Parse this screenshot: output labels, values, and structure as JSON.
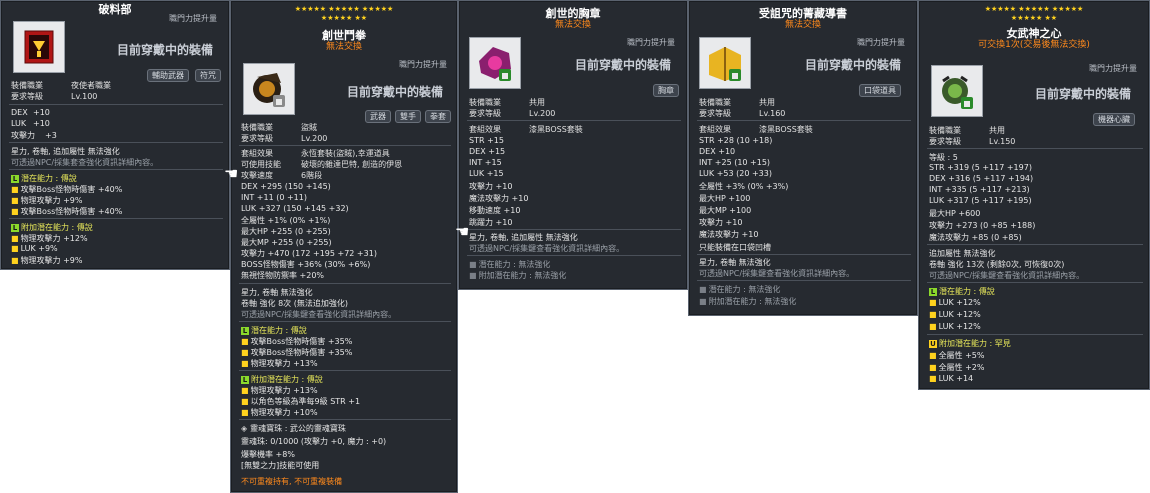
{
  "p1": {
    "title": "破料部",
    "role_power": "職門力提升量",
    "wearing": "目前穿戴中的裝備",
    "job_label": "裝備職業",
    "job_value": "夜使者職業",
    "level_label": "要求等級",
    "level_value": "Lv.100",
    "tags": [
      "輔助武器",
      "符咒"
    ],
    "stats": [
      {
        "k": "DEX",
        "v": "+10"
      },
      {
        "k": "LUK",
        "v": "+10"
      },
      {
        "k": "攻擊力",
        "v": "+3"
      }
    ],
    "info1": "星力, 卷軸, 追加屬性 無法強化",
    "info2": "可透過NPC/採集套查強化資訊詳細內容。",
    "potential_label": "潛在能力 : 傳說",
    "potential_lines": [
      "攻擊Boss怪物時傷害 +40%",
      "物理攻擊力 +9%",
      "攻擊Boss怪物時傷害 +40%"
    ],
    "addpot_label": "附加潛在能力 : 傳說",
    "addpot_lines": [
      "物理攻擊力 +12%",
      "LUK +9%",
      "物理攻擊力 +9%"
    ]
  },
  "p2": {
    "stars_row1": "★★★★★ ★★★★★ ★★★★★",
    "stars_row2": "★★★★★ ★★",
    "title": "創世鬥拳",
    "sub": "無法交換",
    "role_power": "職門力提升量",
    "wearing": "目前穿戴中的裝備",
    "job_label": "裝備職業",
    "job_value": "盜賊",
    "level_label": "要求等級",
    "level_value": "Lv.200",
    "tags": [
      "武器",
      "雙手",
      "拳套"
    ],
    "set_label": "套組效果",
    "set_value": "永恆套裝(盜賊),幸運道具",
    "skill_label": "可使用技能",
    "skill_value": "破壞的雜達巴特, 創造的伊恩",
    "speed_label": "攻擊速度",
    "speed_value": "6階段",
    "stats": [
      "DEX +295 (150 +145)",
      "INT +11 (0 +11)",
      "LUK +327 (150 +145 +32)",
      "全屬性 +1% (0% +1%)",
      "最大HP +255 (0 +255)",
      "最大MP +255 (0 +255)",
      "攻擊力 +470 (172 +195 +72 +31)",
      "BOSS怪物傷害 +36% (30% +6%)",
      "無視怪物防禦率 +20%"
    ],
    "info1": "星力, 卷軸 無法強化",
    "info2": "卷軸 強化 8次 (無法追加強化)",
    "info3": "可透過NPC/採集鍵查看強化資訊詳細內容。",
    "potential_label": "潛在能力 : 傳說",
    "potential_lines": [
      "攻擊Boss怪物時傷害 +35%",
      "攻擊Boss怪物時傷害 +35%",
      "物理攻擊力 +13%"
    ],
    "addpot_label": "附加潛在能力 : 傳說",
    "addpot_lines": [
      "物理攻擊力 +13%",
      "以角色等級為準每9級 STR +1",
      "物理攻擊力 +10%"
    ],
    "soul_label": "靈魂寶珠 : 武公的靈魂寶珠",
    "soul_value": "靈魂珠: 0/1000 (攻擊力 +0, 魔力 : +0)",
    "crit": "爆擊機率 +8%",
    "skill2": "[無雙之力]技能可使用",
    "warning": "不可重複持有, 不可重複裝備"
  },
  "p3": {
    "title": "創世的胸章",
    "sub": "無法交換",
    "role_power": "職門力提升量",
    "wearing": "目前穿戴中的裝備",
    "job_label": "裝備職業",
    "job_value": "共用",
    "level_label": "要求等級",
    "level_value": "Lv.200",
    "tags": [
      "胸章"
    ],
    "set_label": "套組效果",
    "set_value": "漆黑BOSS套裝",
    "stats": [
      "STR +15",
      "DEX +15",
      "INT +15",
      "LUK +15",
      "攻擊力 +10",
      "魔法攻擊力 +10",
      "移動速度 +10",
      "跳躍力 +10"
    ],
    "info1": "星力, 卷軸, 追加屬性 無法強化",
    "info2": "可透過NPC/採集鍵查看強化資訊詳細內容。",
    "pot1": "潛在能力 : 無法強化",
    "pot2": "附加潛在能力 : 無法強化"
  },
  "p4": {
    "title": "受詛咒的菁藏導書",
    "sub": "無法交換",
    "role_power": "職門力提升量",
    "wearing": "目前穿戴中的裝備",
    "job_label": "裝備職業",
    "job_value": "共用",
    "level_label": "要求等級",
    "level_value": "Lv.160",
    "tags": [
      "口袋道具"
    ],
    "set_label": "套組效果",
    "set_value": "漆黑BOSS套裝",
    "stats": [
      "STR +28 (10 +18)",
      "DEX +10",
      "INT +25 (10 +15)",
      "LUK +53 (20 +33)",
      "全屬性 +3% (0% +3%)",
      "最大HP +100",
      "最大MP +100",
      "攻擊力 +10",
      "魔法攻擊力 +10"
    ],
    "slot": "只能裝備在口袋凹槽",
    "info1": "星力, 卷軸 無法強化",
    "info2": "可透過NPC/採集鍵查看強化資訊詳細內容。",
    "pot1": "潛在能力 : 無法強化",
    "pot2": "附加潛在能力 : 無法強化"
  },
  "p5": {
    "stars_row1": "★★★★★ ★★★★★ ★★★★★",
    "stars_row2": "★★★★★ ★★",
    "title": "女武神之心",
    "sub": "可交換1次(交易後無法交換)",
    "role_power": "職門力提升量",
    "wearing": "目前穿戴中的裝備",
    "job_label": "裝備職業",
    "job_value": "共用",
    "level_label": "要求等級",
    "level_value": "Lv.150",
    "tags": [
      "機器心臟"
    ],
    "grade": "等級 : 5",
    "stats": [
      "STR +319 (5 +117 +197)",
      "DEX +316 (5 +117 +194)",
      "INT +335 (5 +117 +213)",
      "LUK +317 (5 +117 +195)",
      "最大HP +600",
      "攻擊力 +273 (0 +85 +188)",
      "魔法攻擊力 +85 (0 +85)"
    ],
    "info1": "追加屬性 無法強化",
    "info2": "卷軸 強化 13次 (剩餘0次, 可恢復0次)",
    "info3": "可透過NPC/採集鍵查看強化資訊詳細內容。",
    "potential_label": "潛在能力 : 傳說",
    "potential_lines": [
      "LUK +12%",
      "LUK +12%",
      "LUK +12%"
    ],
    "addpot_label": "附加潛在能力 : 罕見",
    "addpot_lines": [
      "全屬性 +5%",
      "全屬性 +2%",
      "LUK +14"
    ]
  }
}
